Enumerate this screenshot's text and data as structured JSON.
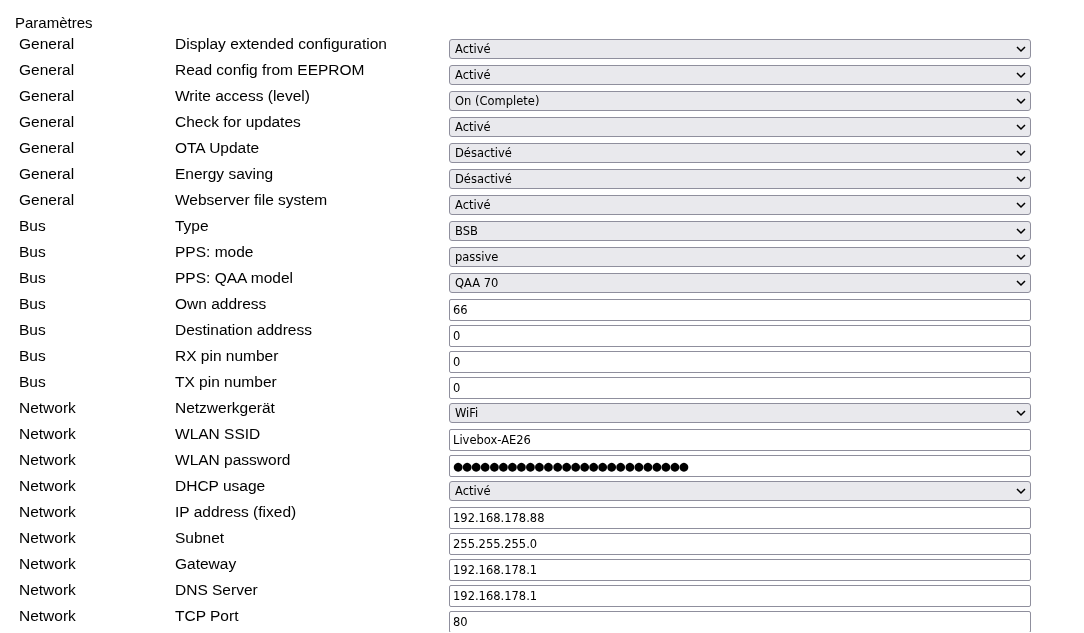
{
  "title": "Paramètres",
  "rows": [
    {
      "category": "General",
      "name": "Display extended configuration",
      "kind": "select",
      "value": "Activé"
    },
    {
      "category": "General",
      "name": "Read config from EEPROM",
      "kind": "select",
      "value": "Activé"
    },
    {
      "category": "General",
      "name": "Write access (level)",
      "kind": "select",
      "value": "On (Complete)"
    },
    {
      "category": "General",
      "name": "Check for updates",
      "kind": "select",
      "value": "Activé"
    },
    {
      "category": "General",
      "name": "OTA Update",
      "kind": "select",
      "value": "Désactivé"
    },
    {
      "category": "General",
      "name": "Energy saving",
      "kind": "select",
      "value": "Désactivé"
    },
    {
      "category": "General",
      "name": "Webserver file system",
      "kind": "select",
      "value": "Activé"
    },
    {
      "category": "Bus",
      "name": "Type",
      "kind": "select",
      "value": "BSB"
    },
    {
      "category": "Bus",
      "name": "PPS: mode",
      "kind": "select",
      "value": "passive"
    },
    {
      "category": "Bus",
      "name": "PPS: QAA model",
      "kind": "select",
      "value": "QAA 70"
    },
    {
      "category": "Bus",
      "name": "Own address",
      "kind": "text",
      "value": "66"
    },
    {
      "category": "Bus",
      "name": "Destination address",
      "kind": "text",
      "value": "0"
    },
    {
      "category": "Bus",
      "name": "RX pin number",
      "kind": "text",
      "value": "0"
    },
    {
      "category": "Bus",
      "name": "TX pin number",
      "kind": "text",
      "value": "0"
    },
    {
      "category": "Network",
      "name": "Netzwerkgerät",
      "kind": "select",
      "value": "WiFi"
    },
    {
      "category": "Network",
      "name": "WLAN SSID",
      "kind": "text",
      "value": "Livebox-AE26"
    },
    {
      "category": "Network",
      "name": "WLAN password",
      "kind": "password",
      "value": "●●●●●●●●●●●●●●●●●●●●●●●●●●"
    },
    {
      "category": "Network",
      "name": "DHCP usage",
      "kind": "select",
      "value": "Activé"
    },
    {
      "category": "Network",
      "name": "IP address (fixed)",
      "kind": "text",
      "value": "192.168.178.88"
    },
    {
      "category": "Network",
      "name": "Subnet",
      "kind": "text",
      "value": "255.255.255.0"
    },
    {
      "category": "Network",
      "name": "Gateway",
      "kind": "text",
      "value": "192.168.178.1"
    },
    {
      "category": "Network",
      "name": "DNS Server",
      "kind": "text",
      "value": "192.168.178.1"
    },
    {
      "category": "Network",
      "name": "TCP Port",
      "kind": "text",
      "value": "80"
    }
  ]
}
